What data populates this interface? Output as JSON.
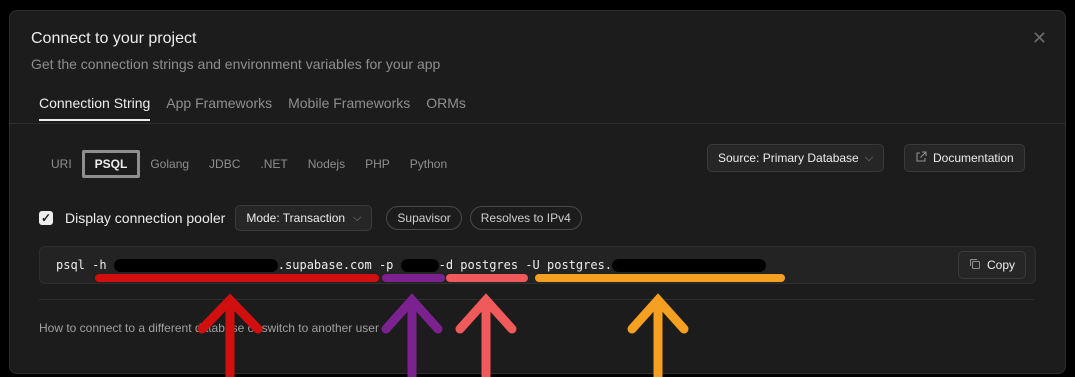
{
  "modal": {
    "title": "Connect to your project",
    "subtitle": "Get the connection strings and environment variables for your app",
    "close_icon": "close-icon"
  },
  "tabs": [
    {
      "label": "Connection String",
      "active": true
    },
    {
      "label": "App Frameworks",
      "active": false
    },
    {
      "label": "Mobile Frameworks",
      "active": false
    },
    {
      "label": "ORMs",
      "active": false
    }
  ],
  "lang_tabs": [
    {
      "label": "URI",
      "active": false
    },
    {
      "label": "PSQL",
      "active": true
    },
    {
      "label": "Golang",
      "active": false
    },
    {
      "label": "JDBC",
      "active": false
    },
    {
      "label": ".NET",
      "active": false
    },
    {
      "label": "Nodejs",
      "active": false
    },
    {
      "label": "PHP",
      "active": false
    },
    {
      "label": "Python",
      "active": false
    }
  ],
  "source": {
    "label": "Source: Primary Database",
    "icon": "chevron-down-icon"
  },
  "documentation": {
    "label": "Documentation",
    "icon": "external-link-icon"
  },
  "pooler": {
    "checked": true,
    "label": "Display connection pooler",
    "mode": "Mode: Transaction",
    "chips": [
      "Supavisor",
      "Resolves to IPv4"
    ]
  },
  "command": {
    "cmd": "psql -h ",
    "host_suffix": ".supabase.com -p ",
    "db_flag": "-d postgres ",
    "user_flag": "-U postgres."
  },
  "copy": {
    "label": "Copy",
    "icon": "copy-icon"
  },
  "footer": {
    "text": "How to connect to a different database or switch to another user"
  },
  "annotations": {
    "colors": {
      "host": "#d20f0f",
      "port": "#7b2290",
      "database": "#f05a5a",
      "user": "#f5a020"
    }
  }
}
